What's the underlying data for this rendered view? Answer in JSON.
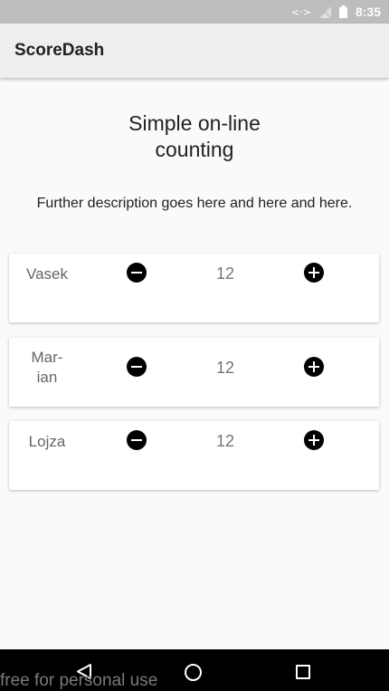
{
  "status_bar": {
    "time": "8:35",
    "data_indicator": "<·>",
    "icons": [
      "data-transfer-icon",
      "no-signal-icon",
      "battery-icon"
    ]
  },
  "app_bar": {
    "title": "ScoreDash"
  },
  "main": {
    "heading_line1": "Simple on-line",
    "heading_line2": "counting",
    "description": "Further description goes here and here and here."
  },
  "players": [
    {
      "name_line1": "Vasek",
      "name_line2": "",
      "score": "12"
    },
    {
      "name_line1": "Mar-",
      "name_line2": "ian",
      "score": "12"
    },
    {
      "name_line1": "Lojza",
      "name_line2": "",
      "score": "12"
    }
  ],
  "nav_bar": {
    "icons": [
      "back-icon",
      "home-icon",
      "recent-apps-icon"
    ]
  },
  "watermark": "free for personal use"
}
